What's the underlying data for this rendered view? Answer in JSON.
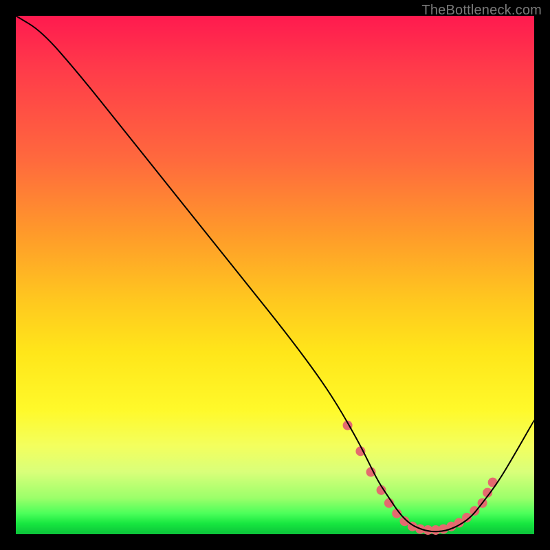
{
  "watermark": "TheBottleneck.com",
  "chart_data": {
    "type": "line",
    "title": "",
    "xlabel": "",
    "ylabel": "",
    "xlim": [
      0,
      100
    ],
    "ylim": [
      0,
      100
    ],
    "series": [
      {
        "name": "bottleneck-curve",
        "x": [
          0,
          5,
          12,
          20,
          28,
          36,
          44,
          52,
          58,
          62,
          66,
          68,
          70,
          72,
          74,
          76,
          78,
          80,
          82,
          84,
          86,
          88,
          90,
          93,
          96,
          100
        ],
        "values": [
          100,
          97,
          89,
          79,
          69,
          59,
          49,
          39,
          31,
          25,
          18,
          14,
          10,
          7,
          4,
          2,
          1,
          0.5,
          0.5,
          1,
          2,
          3.5,
          6,
          10,
          15,
          22
        ]
      }
    ],
    "markers": {
      "name": "highlight-dots",
      "x": [
        64,
        66.5,
        68.5,
        70.5,
        72,
        73.5,
        75,
        76.5,
        78,
        79.5,
        81,
        82.5,
        84,
        85.5,
        87,
        88.5,
        90,
        91,
        92
      ],
      "values": [
        21,
        16,
        12,
        8.5,
        6,
        4,
        2.5,
        1.5,
        1,
        0.8,
        0.8,
        1,
        1.5,
        2.2,
        3.2,
        4.5,
        6,
        8,
        10
      ],
      "color": "#e46a6f",
      "radius": 7
    },
    "curve_color": "#000000",
    "curve_width": 2
  }
}
